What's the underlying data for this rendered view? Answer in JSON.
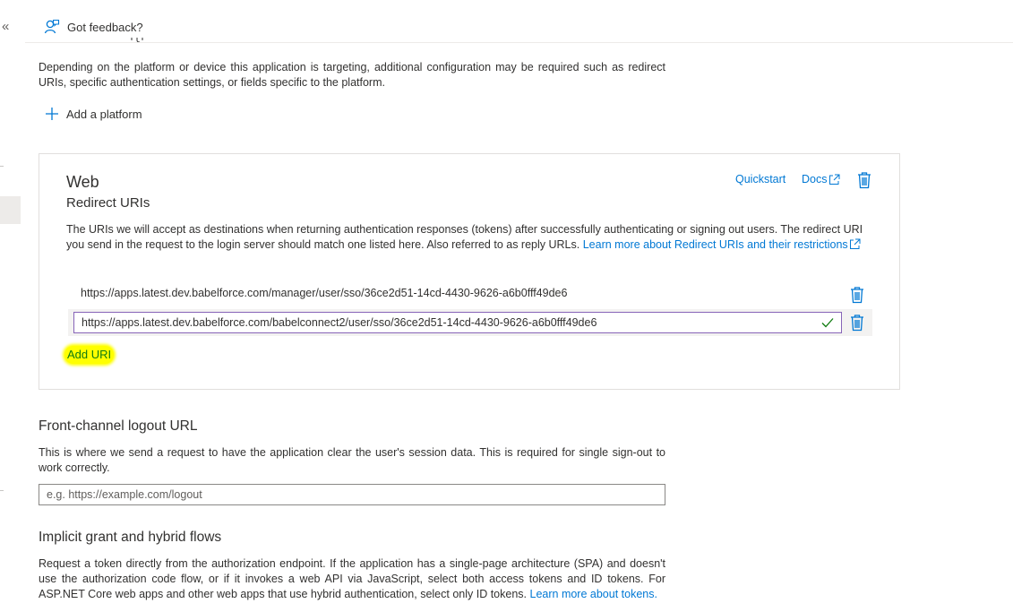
{
  "nav": {
    "collapse_glyph": "«"
  },
  "feedback": {
    "label": "Got feedback?",
    "icon": "feedback-person-icon"
  },
  "platform_section": {
    "description": "Depending on the platform or device this application is targeting, additional configuration may be required such as redirect URIs, specific authentication settings, or fields specific to the platform.",
    "add_platform_label": "Add a platform"
  },
  "web_card": {
    "title": "Web",
    "subtitle": "Redirect URIs",
    "quickstart_label": "Quickstart",
    "docs_label": "Docs",
    "description": "The URIs we will accept as destinations when returning authentication responses (tokens) after successfully authenticating or signing out users. The redirect URI you send in the request to the login server should match one listed here. Also referred to as reply URLs.",
    "learn_more_link": "Learn more about Redirect URIs and their restrictions",
    "redirect_uris": [
      "https://apps.latest.dev.babelforce.com/manager/user/sso/36ce2d51-14cd-4430-9626-a6b0fff49de6",
      "https://apps.latest.dev.babelforce.com/babelconnect2/user/sso/36ce2d51-14cd-4430-9626-a6b0fff49de6"
    ],
    "add_uri_label": "Add URI"
  },
  "front_channel": {
    "title": "Front-channel logout URL",
    "description": "This is where we send a request to have the application clear the user's session data. This is required for single sign-out to work correctly.",
    "placeholder": "e.g. https://example.com/logout"
  },
  "implicit_grant": {
    "title": "Implicit grant and hybrid flows",
    "description": "Request a token directly from the authorization endpoint. If the application has a single-page architecture (SPA) and doesn't use the authorization code flow, or if it invokes a web API via JavaScript, select both access tokens and ID tokens. For ASP.NET Core web apps and other web apps that use hybrid authentication, select only ID tokens.",
    "learn_more_link": "Learn more about tokens."
  },
  "colors": {
    "link": "#0078d4",
    "input_focus_border": "#8764b8",
    "valid_check": "#107c10",
    "highlight": "#ffff00"
  }
}
